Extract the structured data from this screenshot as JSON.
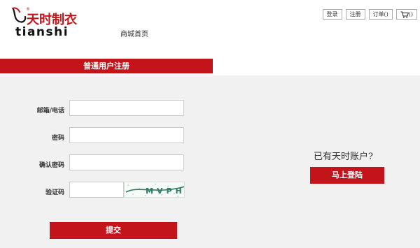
{
  "brand": {
    "name_cn": "天时制衣",
    "name_en": "tianshi",
    "reg_mark": "®"
  },
  "nav": {
    "home": "商城首页"
  },
  "top_links": {
    "login": "登录",
    "register": "注册",
    "orders": "订单()",
    "cart": "()"
  },
  "form": {
    "title": "普通用户注册",
    "email_phone_label": "邮箱/电话",
    "password_label": "密码",
    "confirm_password_label": "确认密码",
    "captcha_label": "验证码",
    "captcha_text": "MVPH",
    "submit_label": "提交"
  },
  "side": {
    "has_account_text": "已有天时账户?",
    "login_now_label": "马上登陆"
  },
  "colors": {
    "brand_red": "#c3141b",
    "panel_bg": "#f1f1f1"
  }
}
